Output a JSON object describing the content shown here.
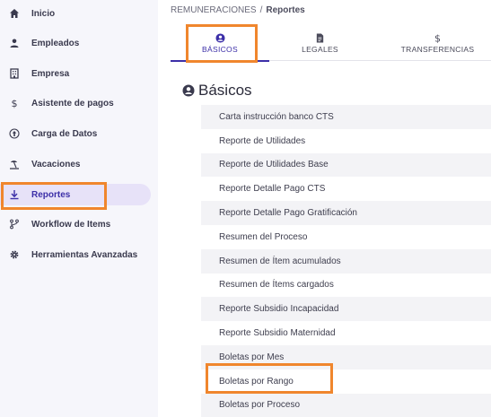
{
  "sidebar": {
    "items": [
      {
        "label": "Inicio",
        "icon": "home-icon",
        "active": false
      },
      {
        "label": "Empleados",
        "icon": "user-icon",
        "active": false
      },
      {
        "label": "Empresa",
        "icon": "building-icon",
        "active": false
      },
      {
        "label": "Asistente de pagos",
        "icon": "dollar-icon",
        "active": false
      },
      {
        "label": "Carga de Datos",
        "icon": "upload-icon",
        "active": false
      },
      {
        "label": "Vacaciones",
        "icon": "beach-icon",
        "active": false
      },
      {
        "label": "Reportes",
        "icon": "download-icon",
        "active": true
      },
      {
        "label": "Workflow de Items",
        "icon": "branch-icon",
        "active": false
      },
      {
        "label": "Herramientas Avanzadas",
        "icon": "gear-icon",
        "active": false
      }
    ]
  },
  "breadcrumb": {
    "parent": "REMUNERACIONES",
    "separator": "/",
    "current": "Reportes"
  },
  "tabs": [
    {
      "label": "BÁSICOS",
      "icon": "user-circle-icon",
      "active": true
    },
    {
      "label": "LEGALES",
      "icon": "document-icon",
      "active": false
    },
    {
      "label": "TRANSFERENCIAS",
      "icon": "dollar-icon",
      "active": false
    }
  ],
  "section": {
    "title": "Básicos",
    "icon": "user-circle-icon"
  },
  "reports": [
    "Carta instrucción banco CTS",
    "Reporte de Utilidades",
    "Reporte de Utilidades Base",
    "Reporte Detalle Pago CTS",
    "Reporte Detalle Pago Gratificación",
    "Resumen del Proceso",
    "Resumen de Ítem acumulados",
    "Resumen de Ítems cargados",
    "Reporte Subsidio Incapacidad",
    "Reporte Subsidio Maternidad",
    "Boletas por Mes",
    "Boletas por Rango",
    "Boletas por Proceso"
  ],
  "colors": {
    "accent": "#3c2fa8",
    "highlight": "#f0862d",
    "sidebar_bg": "#f6f6fb",
    "active_bg": "#e7e2f8"
  }
}
